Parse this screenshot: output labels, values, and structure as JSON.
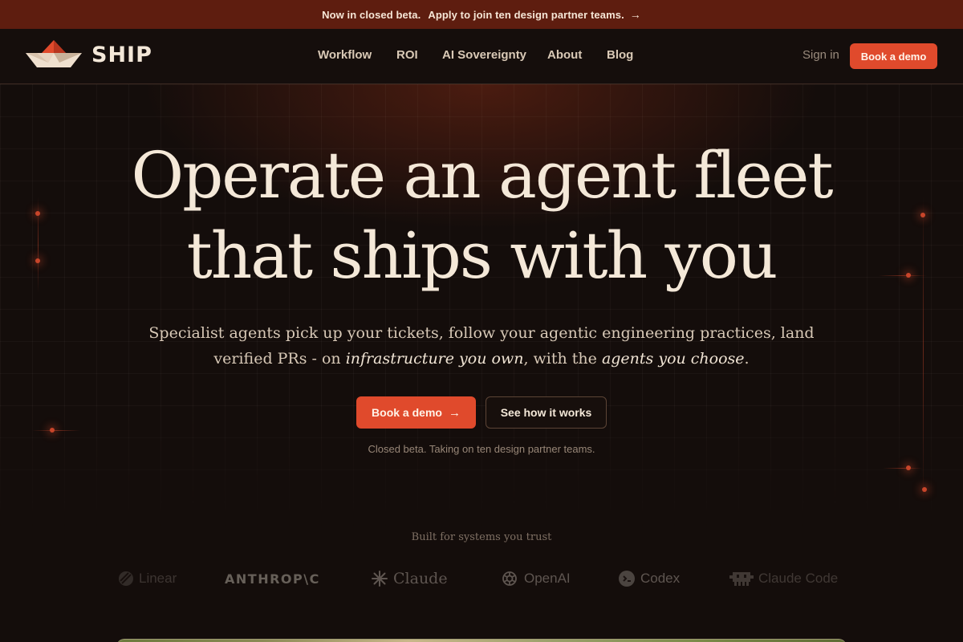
{
  "banner": {
    "lead": "Now in closed beta.",
    "cta": "Apply to join ten design partner teams.",
    "arrow": "→"
  },
  "header": {
    "brand": "SHIP",
    "nav": [
      "Workflow",
      "ROI",
      "AI Sovereignty",
      "About",
      "Blog"
    ],
    "signin": "Sign in",
    "demo": "Book a demo"
  },
  "hero": {
    "headline_line1": "Operate an agent fleet",
    "headline_line2": "that ships with you",
    "sub_line1": "Specialist agents pick up your tickets, follow your agentic engineering practices, land",
    "sub_line2_a": "verified PRs - on ",
    "sub_line2_b": "infrastructure you own",
    "sub_line2_c": ", with the ",
    "sub_line2_d": "agents you choose",
    "sub_line2_e": ".",
    "primary_cta": "Book a demo",
    "primary_arrow": "→",
    "secondary_cta": "See how it works",
    "note": "Closed beta. Taking on ten design partner teams."
  },
  "trust": {
    "title": "Built for systems you trust",
    "brands": [
      "Linear",
      "ANTHROP\\C",
      "Claude",
      "OpenAI",
      "Codex",
      "Claude Code"
    ]
  },
  "colors": {
    "accent": "#e04a2c",
    "banner": "#5e1d0f",
    "background": "#140d0b",
    "text": "#f4e8d8"
  }
}
